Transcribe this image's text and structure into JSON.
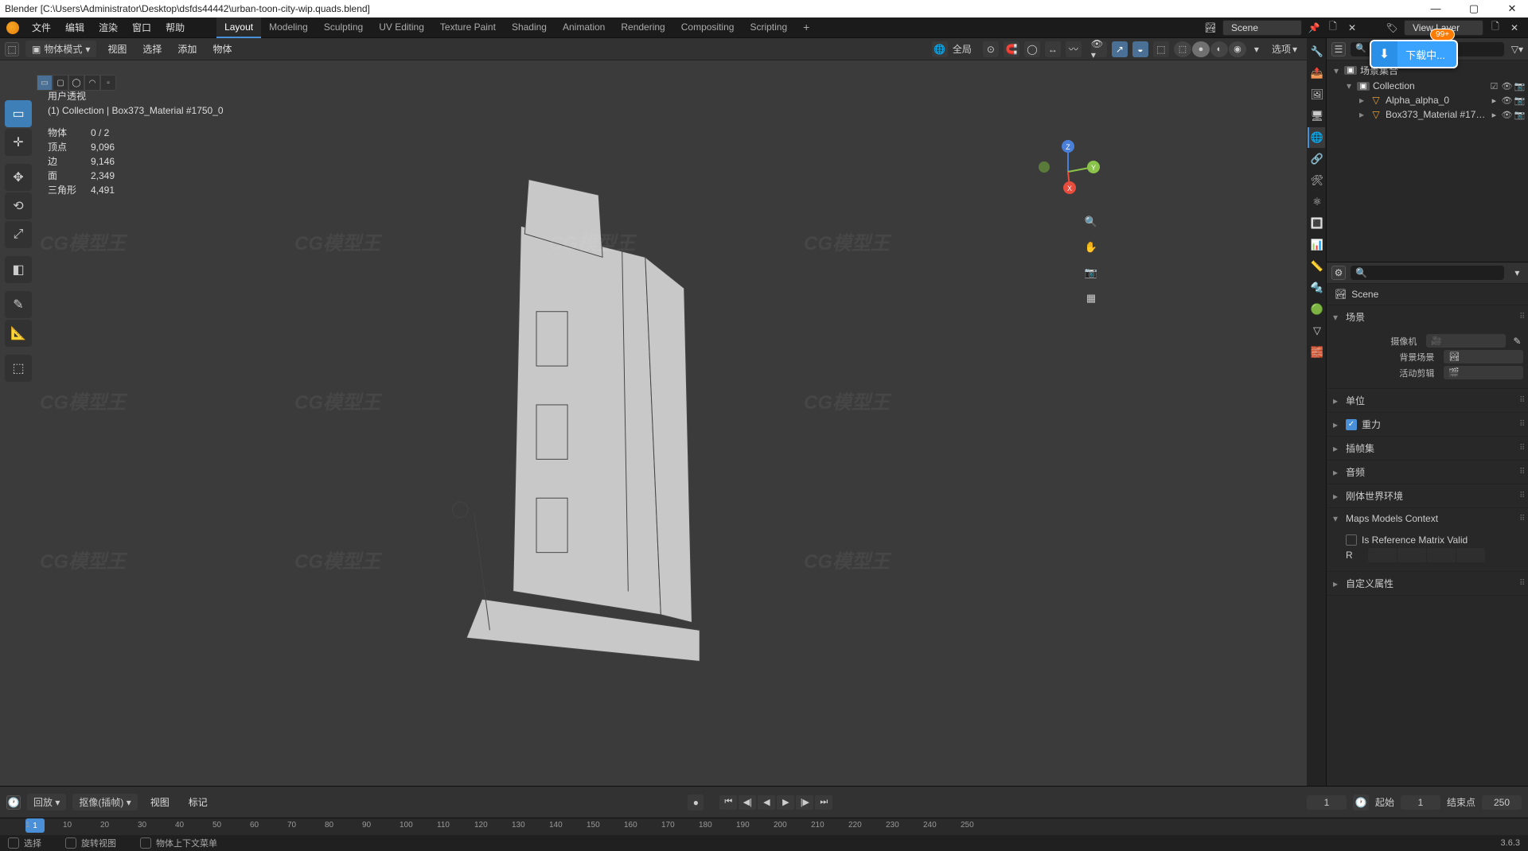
{
  "window": {
    "title": "Blender [C:\\Users\\Administrator\\Desktop\\dsfds44442\\urban-toon-city-wip.quads.blend]"
  },
  "topmenu": {
    "items": [
      "文件",
      "编辑",
      "渲染",
      "窗口",
      "帮助"
    ],
    "workspaces": [
      "Layout",
      "Modeling",
      "Sculpting",
      "UV Editing",
      "Texture Paint",
      "Shading",
      "Animation",
      "Rendering",
      "Compositing",
      "Scripting"
    ],
    "active_workspace": "Layout",
    "scene_label": "Scene",
    "viewlayer_label": "View Layer"
  },
  "download": {
    "text": "下载中...",
    "badge": "99+"
  },
  "viewport": {
    "mode": "物体模式",
    "menus": [
      "视图",
      "选择",
      "添加",
      "物体"
    ],
    "global": "全局",
    "options": "选项",
    "hud": {
      "perspective": "用户透视",
      "collection": "(1) Collection | Box373_Material #1750_0",
      "stats": [
        {
          "l": "物体",
          "v": "0 / 2"
        },
        {
          "l": "顶点",
          "v": "9,096"
        },
        {
          "l": "边",
          "v": "9,146"
        },
        {
          "l": "面",
          "v": "2,349"
        },
        {
          "l": "三角形",
          "v": "4,491"
        }
      ]
    }
  },
  "outliner": {
    "root": "场景集合",
    "items": [
      {
        "name": "Collection",
        "icon": "collection",
        "depth": 1,
        "flags": [
          "☑",
          "👁",
          "📷"
        ]
      },
      {
        "name": "Alpha_alpha_0",
        "icon": "mesh",
        "depth": 2,
        "flags": [
          "▸",
          "👁",
          "📷"
        ]
      },
      {
        "name": "Box373_Material #17…",
        "icon": "mesh",
        "depth": 2,
        "flags": [
          "▸",
          "👁",
          "📷"
        ]
      }
    ]
  },
  "properties": {
    "search_placeholder": "",
    "crumb": "Scene",
    "panels": {
      "scene": {
        "title": "场景",
        "open": true,
        "rows": [
          {
            "lbl": "摄像机",
            "icon": "🎥"
          },
          {
            "lbl": "背景场景",
            "icon": "🖼"
          },
          {
            "lbl": "活动剪辑",
            "icon": "🎬"
          }
        ]
      },
      "units": {
        "title": "单位",
        "open": false
      },
      "gravity": {
        "title": "重力",
        "open": false,
        "checked": true
      },
      "keying": {
        "title": "插帧集",
        "open": false
      },
      "audio": {
        "title": "音频",
        "open": false
      },
      "rigid": {
        "title": "刚体世界环境",
        "open": false
      },
      "maps": {
        "title": "Maps Models Context",
        "open": true,
        "check_label": "Is Reference Matrix Valid",
        "matrix_label": "R"
      },
      "custom": {
        "title": "自定义属性",
        "open": false
      }
    }
  },
  "timeline": {
    "playback": "回放",
    "keying": "抠像(插帧)",
    "menus": [
      "视图",
      "标记"
    ],
    "current": "1",
    "start_lbl": "起始",
    "start": "1",
    "end_lbl": "结束点",
    "end": "250",
    "ticks": [
      "1",
      "10",
      "20",
      "30",
      "40",
      "50",
      "60",
      "70",
      "80",
      "90",
      "100",
      "110",
      "120",
      "130",
      "140",
      "150",
      "160",
      "170",
      "180",
      "190",
      "200",
      "210",
      "220",
      "230",
      "240",
      "250"
    ]
  },
  "statusbar": {
    "select": "选择",
    "rotate": "旋转视图",
    "context": "物体上下文菜单",
    "version": "3.6.3"
  },
  "prop_tab_icons": [
    "🔧",
    "📤",
    "🖼",
    "🖥",
    "🌐",
    "🔗",
    "🛠",
    "⚛",
    "🔳",
    "📊",
    "📏",
    "🔩",
    "🟢",
    "▽",
    "🧱"
  ]
}
